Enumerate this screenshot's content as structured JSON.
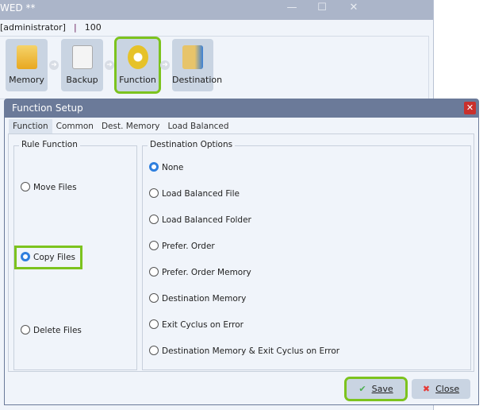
{
  "background_window": {
    "title": "WED **",
    "user": "[administrator]",
    "separator": "|",
    "value": "100",
    "steps": [
      {
        "label": "Memory",
        "icon": "memory-icon"
      },
      {
        "label": "Backup",
        "icon": "backup-icon"
      },
      {
        "label": "Function",
        "icon": "gear-icon"
      },
      {
        "label": "Destination",
        "icon": "destination-folder-icon"
      }
    ]
  },
  "dialog": {
    "title": "Function Setup",
    "tabs": [
      {
        "label": "Function",
        "active": true
      },
      {
        "label": "Common"
      },
      {
        "label": "Dest. Memory"
      },
      {
        "label": "Load Balanced"
      }
    ],
    "rule_function": {
      "title": "Rule Function",
      "options": [
        {
          "label": "Move Files",
          "selected": false
        },
        {
          "label": "Copy Files",
          "selected": true
        },
        {
          "label": "Delete Files",
          "selected": false
        }
      ]
    },
    "destination_options": {
      "title": "Destination Options",
      "options": [
        {
          "label": "None",
          "selected": true
        },
        {
          "label": "Load Balanced File"
        },
        {
          "label": "Load Balanced Folder"
        },
        {
          "label": "Prefer. Order"
        },
        {
          "label": "Prefer. Order Memory"
        },
        {
          "label": "Destination Memory"
        },
        {
          "label": "Exit Cyclus on Error"
        },
        {
          "label": "Destination Memory & Exit Cyclus on Error"
        }
      ]
    },
    "save": "Save",
    "close": "Close"
  },
  "colors": {
    "highlight": "#7cc31e",
    "accent": "#2f7fde",
    "title_bar": "#6b7a99"
  }
}
